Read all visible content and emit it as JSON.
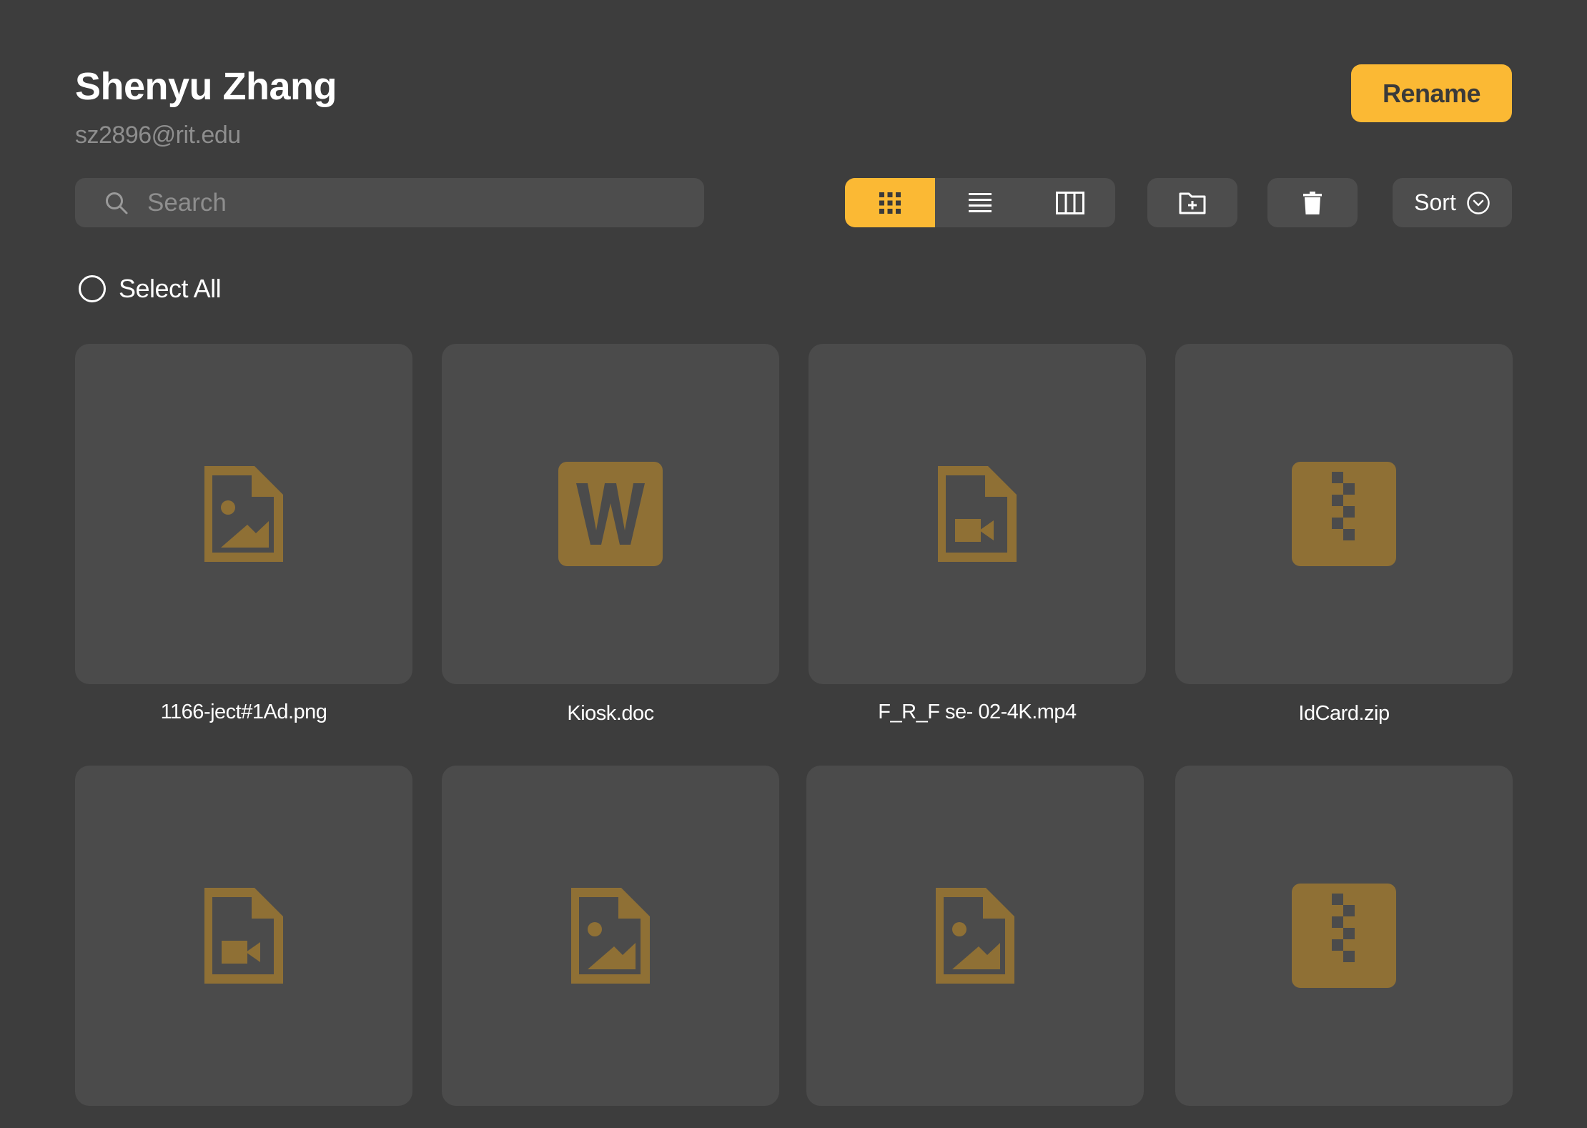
{
  "user": {
    "name": "Shenyu Zhang",
    "email": "sz2896@rit.edu"
  },
  "toolbar": {
    "rename_label": "Rename",
    "search_placeholder": "Search",
    "search_value": "",
    "view_modes": [
      "grid",
      "list",
      "columns"
    ],
    "active_view": "grid",
    "sort_label": "Sort"
  },
  "select_all_label": "Select All",
  "colors": {
    "accent": "#fbb934",
    "file_icon": "#8f7035",
    "card_bg": "#4b4b4b",
    "page_bg": "#3d3d3d"
  },
  "files": [
    {
      "name": "1166-ject#1Ad.png",
      "icon": "image-file-icon"
    },
    {
      "name": "Kiosk.doc",
      "icon": "word-doc-icon"
    },
    {
      "name": "F_R_F se- 02-4K.mp4",
      "icon": "video-file-icon"
    },
    {
      "name": "IdCard.zip",
      "icon": "zip-archive-icon"
    },
    {
      "name": "",
      "icon": "video-file-icon"
    },
    {
      "name": "",
      "icon": "image-file-icon"
    },
    {
      "name": "",
      "icon": "image-file-icon"
    },
    {
      "name": "",
      "icon": "zip-archive-icon"
    }
  ]
}
